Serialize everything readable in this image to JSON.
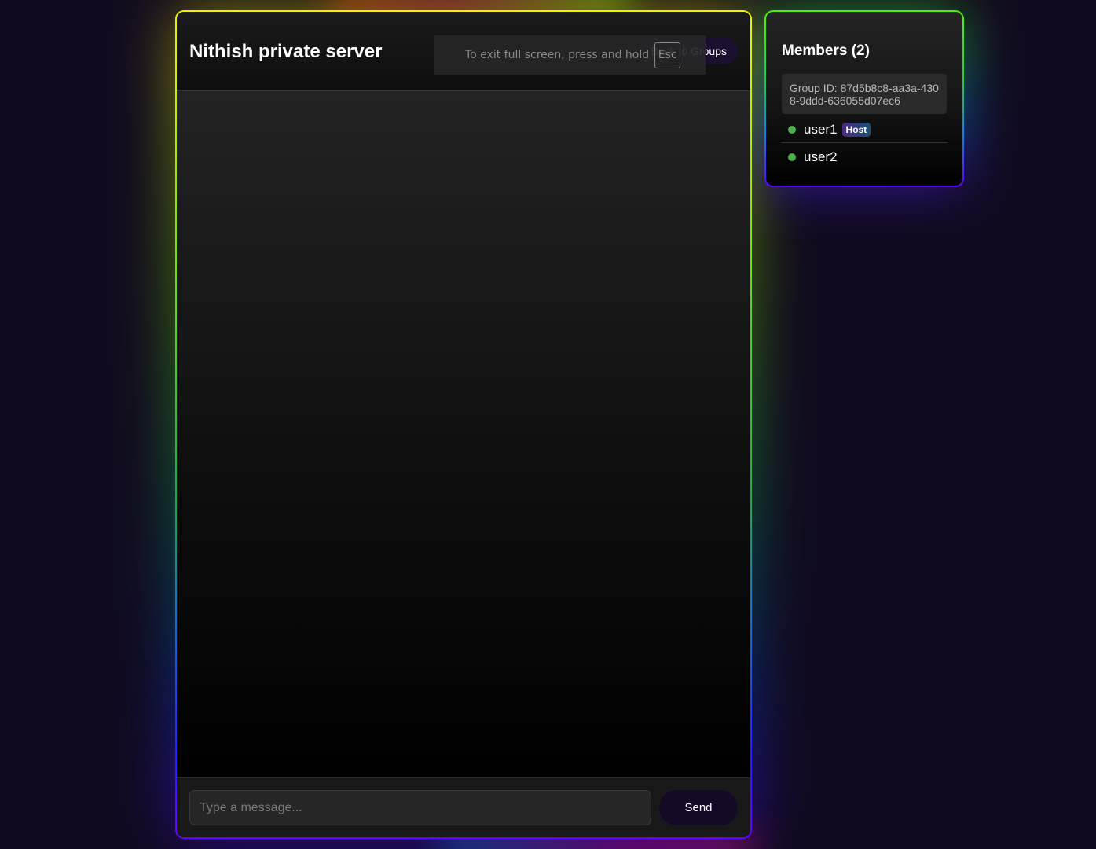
{
  "chat": {
    "title": "Nithish private server",
    "back_label": "Back to Groups",
    "input_placeholder": "Type a message...",
    "send_label": "Send",
    "messages": []
  },
  "fullscreen_notice": {
    "text": "To exit full screen, press and hold",
    "key": "Esc"
  },
  "members": {
    "title": "Members (2)",
    "group_id": "Group ID: 87d5b8c8-aa3a-4308-9ddd-636055d07ec6",
    "list": [
      {
        "name": "user1",
        "badge": "Host",
        "status": "online"
      },
      {
        "name": "user2",
        "badge": "",
        "status": "online"
      }
    ]
  },
  "colors": {
    "background": "#110a1e",
    "online": "#4caf50",
    "button": "#150a26"
  },
  "icons": {
    "status": "online-status-dot-icon"
  }
}
